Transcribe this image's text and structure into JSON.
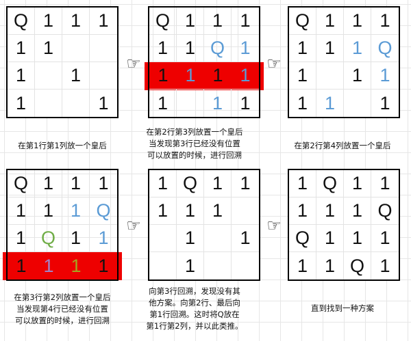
{
  "colors": {
    "black": "#111111",
    "blue": "#5b9bd5",
    "green": "#70ad47",
    "purple": "#a084c8",
    "olive": "#a5a51f",
    "red": "#ee0000"
  },
  "hand_icon": "pointing-hand-icon",
  "hand_glyph": "☞",
  "panels": [
    {
      "board": [
        [
          "Q",
          "1",
          "1",
          "1"
        ],
        [
          "1",
          "1",
          "",
          ""
        ],
        [
          "1",
          "",
          "1",
          ""
        ],
        [
          "1",
          "",
          "",
          "1"
        ]
      ],
      "cell_colors": {},
      "red_row": null,
      "caption": "在第1行第1列放一个皇后"
    },
    {
      "board": [
        [
          "Q",
          "1",
          "1",
          "1"
        ],
        [
          "1",
          "1",
          "Q",
          "1"
        ],
        [
          "1",
          "1",
          "1",
          "1"
        ],
        [
          "1",
          "",
          "1",
          "1"
        ]
      ],
      "cell_colors": {
        "1-2": "blue",
        "1-3": "blue",
        "2-1": "blue",
        "2-3": "blue",
        "3-2": "blue"
      },
      "red_row": 2,
      "caption": "在第2行第3列放置一个皇后\n当发现第3行已经没有位置\n可以放置的时候，进行回溯"
    },
    {
      "board": [
        [
          "Q",
          "1",
          "1",
          "1"
        ],
        [
          "1",
          "1",
          "1",
          "Q"
        ],
        [
          "1",
          "",
          "1",
          "1"
        ],
        [
          "1",
          "1",
          "",
          "1"
        ]
      ],
      "cell_colors": {
        "1-2": "blue",
        "1-3": "blue",
        "2-3": "blue",
        "3-1": "blue"
      },
      "red_row": null,
      "caption": "在第2行第4列放置一个皇后"
    },
    {
      "board": [
        [
          "Q",
          "1",
          "1",
          "1"
        ],
        [
          "1",
          "1",
          "1",
          "Q"
        ],
        [
          "1",
          "Q",
          "1",
          "1"
        ],
        [
          "1",
          "1",
          "1",
          "1"
        ]
      ],
      "cell_colors": {
        "1-2": "blue",
        "1-3": "blue",
        "2-1": "green",
        "2-3": "blue",
        "3-1": "purple",
        "3-2": "olive"
      },
      "red_row": 3,
      "caption": "在第3行第2列放置一个皇后\n当发现第4行已经没有位置\n可以放置的时候，进行回溯"
    },
    {
      "board": [
        [
          "1",
          "Q",
          "1",
          "1"
        ],
        [
          "1",
          "1",
          "1",
          ""
        ],
        [
          "",
          "1",
          "",
          "1"
        ],
        [
          "",
          "1",
          "",
          ""
        ]
      ],
      "cell_colors": {},
      "red_row": null,
      "caption": "向第3行回溯，发现没有其\n他方案。向第2行、最后向\n第1行回溯。这时将Q放在\n第1行第2列，并以此类推。"
    },
    {
      "board": [
        [
          "1",
          "Q",
          "1",
          "1"
        ],
        [
          "1",
          "1",
          "1",
          "Q"
        ],
        [
          "Q",
          "1",
          "1",
          "1"
        ],
        [
          "1",
          "1",
          "Q",
          "1"
        ]
      ],
      "cell_colors": {},
      "red_row": null,
      "caption": "直到找到一种方案"
    }
  ]
}
